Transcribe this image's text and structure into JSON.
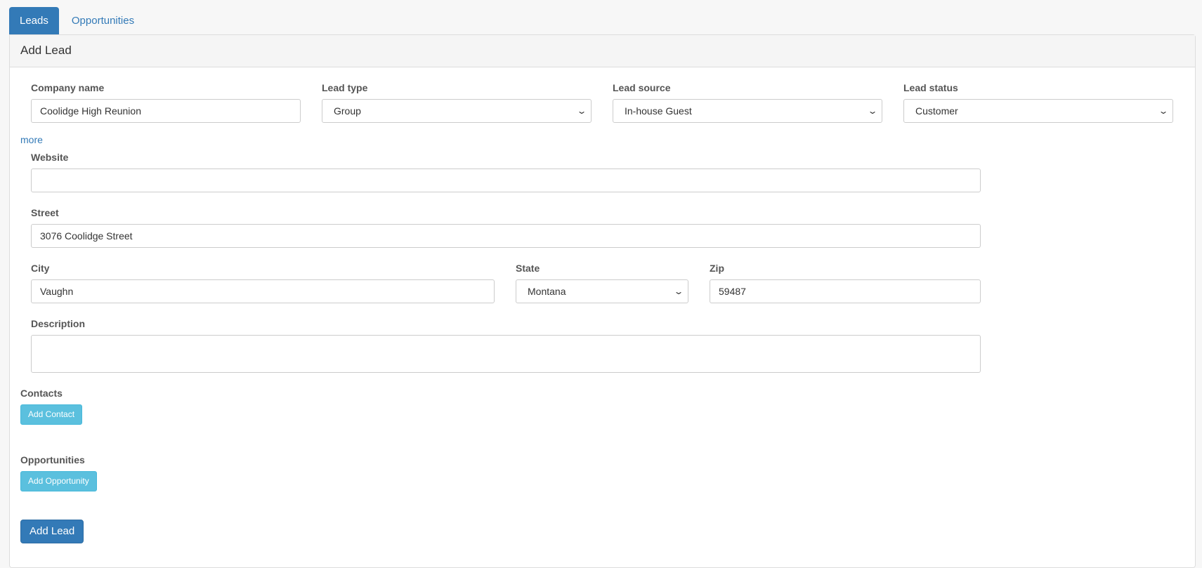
{
  "tabs": [
    {
      "label": "Leads"
    },
    {
      "label": "Opportunities"
    }
  ],
  "panel": {
    "title": "Add Lead"
  },
  "form": {
    "company_name": {
      "label": "Company name",
      "value": "Coolidge High Reunion"
    },
    "lead_type": {
      "label": "Lead type",
      "value": "Group"
    },
    "lead_source": {
      "label": "Lead source",
      "value": "In-house Guest"
    },
    "lead_status": {
      "label": "Lead status",
      "value": "Customer"
    },
    "more_link": "more",
    "website": {
      "label": "Website",
      "value": ""
    },
    "street": {
      "label": "Street",
      "value": "3076 Coolidge Street"
    },
    "city": {
      "label": "City",
      "value": "Vaughn"
    },
    "state": {
      "label": "State",
      "value": "Montana"
    },
    "zip": {
      "label": "Zip",
      "value": "59487"
    },
    "description": {
      "label": "Description",
      "value": ""
    }
  },
  "contacts": {
    "heading": "Contacts",
    "button": "Add Contact"
  },
  "opportunities": {
    "heading": "Opportunities",
    "button": "Add Opportunity"
  },
  "submit": {
    "label": "Add Lead"
  },
  "icons": {
    "select_chevron": "chevron-down-icon"
  },
  "colors": {
    "primary": "#337ab7",
    "info": "#5bc0de"
  }
}
